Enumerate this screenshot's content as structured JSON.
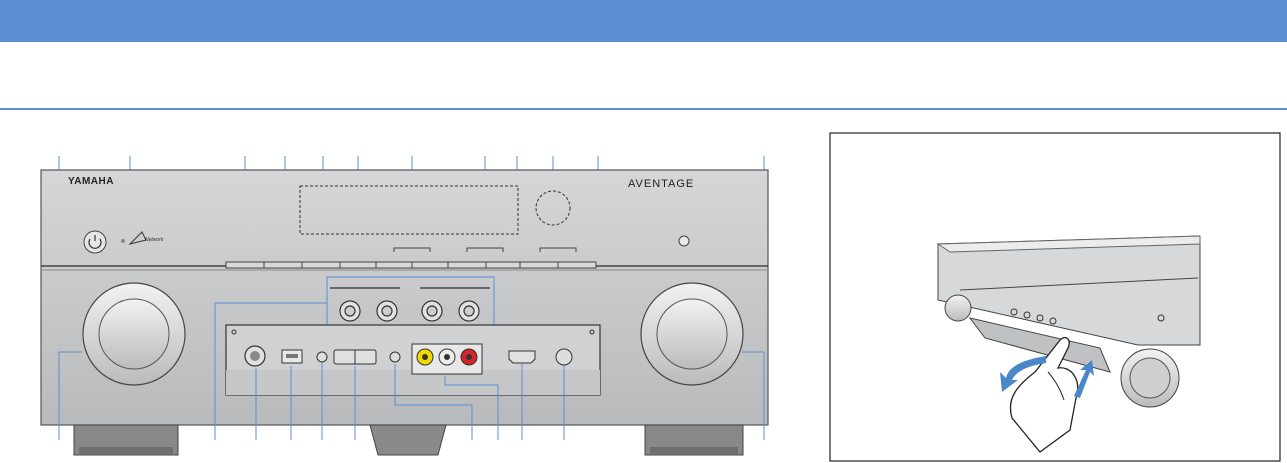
{
  "receiver": {
    "brand_wordmark": "YAMAHA",
    "series_wordmark": "AVENTAGE",
    "network_mark": "Network"
  },
  "colors": {
    "header_bar": "#5B8ED3",
    "rule": "#5B8ED3",
    "panel_face": "#c4c6c8",
    "panel_face_light": "#dedfe0",
    "accent_arrow": "#4a87c9",
    "composite_yellow": "#f0d800",
    "composite_red": "#d8232a"
  },
  "icons": [
    "power-icon",
    "headphones-icon",
    "usb-icon",
    "hdmi-icon",
    "front-door-open-arrow-icon"
  ]
}
